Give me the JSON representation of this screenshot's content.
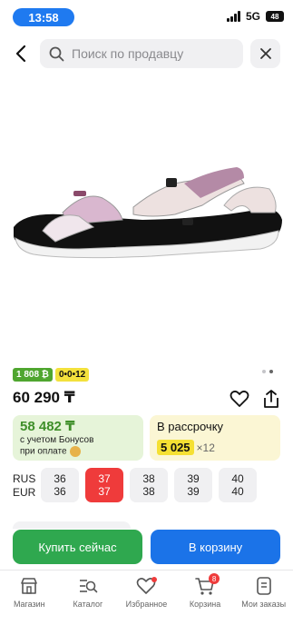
{
  "status": {
    "time": "13:58",
    "network": "5G",
    "battery": "48"
  },
  "search": {
    "placeholder": "Поиск по продавцу"
  },
  "product": {
    "badge_bonus": "1 808 ₿",
    "badge_installment": "0•0•12",
    "price": "60 290 ₸",
    "image_icon": "sandal-image"
  },
  "bonus_card": {
    "price": "58 482 ₸",
    "note_line1": "с учетом Бонусов",
    "note_line2": "при оплате"
  },
  "installment_card": {
    "title": "В рассрочку",
    "amount": "5 025",
    "multiplier": "×12"
  },
  "sizes": {
    "label_1": "RUS",
    "label_2": "EUR",
    "items": [
      {
        "rus": "36",
        "eur": "36"
      },
      {
        "rus": "37",
        "eur": "37"
      },
      {
        "rus": "38",
        "eur": "38"
      },
      {
        "rus": "39",
        "eur": "39"
      },
      {
        "rus": "40",
        "eur": "40"
      }
    ],
    "selected_index": 1
  },
  "actions": {
    "buy_now": "Купить сейчас",
    "add_to_cart": "В корзину"
  },
  "bottom_nav": {
    "items": [
      {
        "label": "Магазин",
        "icon": "store-icon"
      },
      {
        "label": "Каталог",
        "icon": "catalog-icon"
      },
      {
        "label": "Избранное",
        "icon": "heart-icon"
      },
      {
        "label": "Корзина",
        "icon": "cart-icon"
      },
      {
        "label": "Мои заказы",
        "icon": "orders-icon"
      }
    ],
    "cart_count": "8"
  },
  "colors": {
    "accent_blue": "#1b73e8",
    "buy_green": "#2fa84f",
    "selected_red": "#ef3b3b",
    "bonus_green": "#4fa62f",
    "installment_yellow": "#f3e13c"
  }
}
